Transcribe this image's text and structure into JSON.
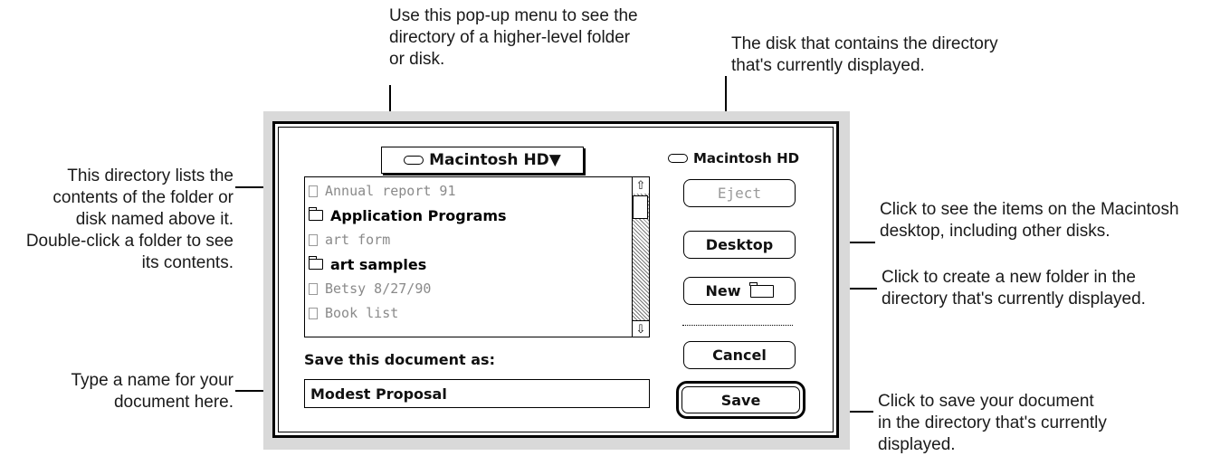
{
  "callouts": {
    "popup_menu": "Use this pop-up menu to see the\ndirectory of a higher-level folder\nor disk.",
    "disk": "The disk that contains the directory\nthat's currently displayed.",
    "directory": "This directory lists the\ncontents of the  folder or\ndisk named above it.\nDouble-click a folder to see\nits contents.",
    "desktop": "Click to see the items on the Macintosh\ndesktop, including other disks.",
    "new_folder": "Click to create a new folder in the\ndirectory that's currently displayed.",
    "name_field": "Type a name for your\ndocument here.",
    "save": "Click to save your document\nin the directory that's currently\ndisplayed."
  },
  "dialog": {
    "popup_label": "Macintosh HD▼",
    "disk_name": "Macintosh HD",
    "files": [
      {
        "name": "Annual report 91",
        "kind": "document"
      },
      {
        "name": "Application Programs",
        "kind": "folder"
      },
      {
        "name": "art form",
        "kind": "document"
      },
      {
        "name": "art samples",
        "kind": "folder"
      },
      {
        "name": "Betsy 8/27/90",
        "kind": "document"
      },
      {
        "name": "Book list",
        "kind": "document"
      }
    ],
    "buttons": {
      "eject": "Eject",
      "desktop": "Desktop",
      "new": "New",
      "cancel": "Cancel",
      "save": "Save"
    },
    "save_label": "Save this document as:",
    "document_name": "Modest Proposal"
  }
}
